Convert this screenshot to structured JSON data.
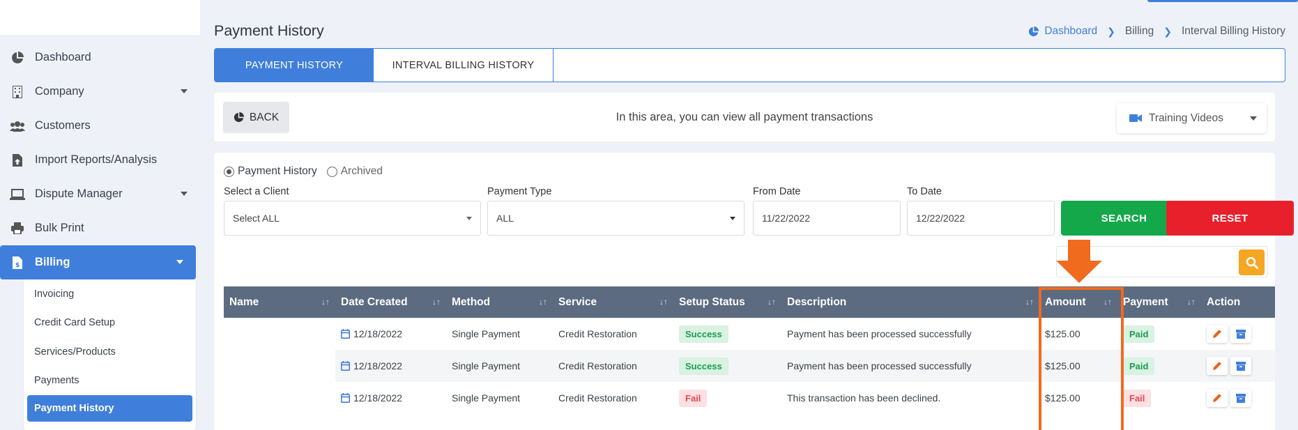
{
  "sidebar": {
    "items": [
      {
        "label": "Dashboard",
        "icon": "pie-chart-icon"
      },
      {
        "label": "Company",
        "icon": "building-icon",
        "has_caret": true
      },
      {
        "label": "Customers",
        "icon": "users-icon"
      },
      {
        "label": "Import Reports/Analysis",
        "icon": "file-upload-icon"
      },
      {
        "label": "Dispute Manager",
        "icon": "laptop-icon",
        "has_caret": true
      },
      {
        "label": "Bulk Print",
        "icon": "printer-icon"
      },
      {
        "label": "Billing",
        "icon": "invoice-icon",
        "has_caret": true,
        "active": true
      }
    ],
    "billing_submenu": [
      "Invoicing",
      "Credit Card Setup",
      "Services/Products",
      "Payments",
      "Payment History"
    ]
  },
  "header": {
    "title": "Payment History",
    "breadcrumb": [
      "Dashboard",
      "Billing",
      "Interval Billing History"
    ]
  },
  "tabs": [
    {
      "label": "PAYMENT HISTORY",
      "active": true
    },
    {
      "label": "INTERVAL BILLING HISTORY",
      "active": false
    }
  ],
  "infobar": {
    "back_label": "BACK",
    "text": "In this area, you can view all payment transactions",
    "training_label": "Training Videos"
  },
  "filters": {
    "radio_payment_history": "Payment History",
    "radio_archived": "Archived",
    "client_label": "Select a Client",
    "client_value": "Select ALL",
    "payment_type_label": "Payment Type",
    "payment_type_value": "ALL",
    "from_label": "From Date",
    "from_value": "11/22/2022",
    "to_label": "To Date",
    "to_value": "12/22/2022",
    "search_label": "SEARCH",
    "reset_label": "RESET"
  },
  "table": {
    "columns": [
      "Name",
      "Date Created",
      "Method",
      "Service",
      "Setup Status",
      "Description",
      "Amount",
      "Payment",
      "Action"
    ],
    "rows": [
      {
        "name": "",
        "date": "12/18/2022",
        "method": "Single Payment",
        "service": "Credit Restoration",
        "status": "Success",
        "description": "Payment has been processed successfully",
        "amount": "$125.00",
        "payment": "Paid"
      },
      {
        "name": "",
        "date": "12/18/2022",
        "method": "Single Payment",
        "service": "Credit Restoration",
        "status": "Success",
        "description": "Payment has been processed successfully",
        "amount": "$125.00",
        "payment": "Paid"
      },
      {
        "name": "",
        "date": "12/18/2022",
        "method": "Single Payment",
        "service": "Credit Restoration",
        "status": "Fail",
        "description": "This transaction has been declined.",
        "amount": "$125.00",
        "payment": "Fail"
      }
    ]
  },
  "colors": {
    "primary": "#3f7fdb",
    "search": "#14a84b",
    "reset": "#e8202c",
    "highlight": "#f06b1e",
    "table_header": "#5c6b80"
  }
}
